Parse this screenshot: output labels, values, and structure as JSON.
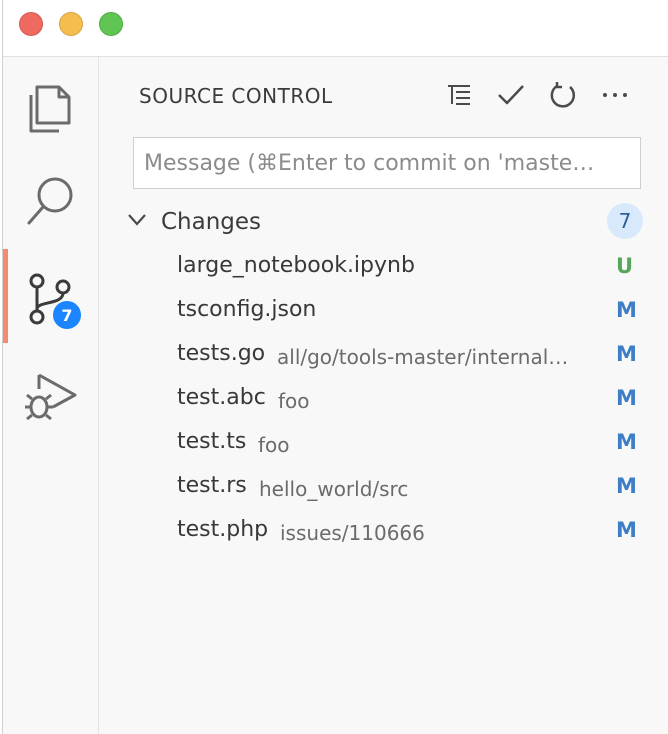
{
  "window": {
    "controls": [
      "close",
      "minimize",
      "maximize"
    ],
    "colors": {
      "close": "#ee6a5f",
      "minimize": "#f5bd4f",
      "maximize": "#61c554"
    }
  },
  "activity_bar": {
    "items": [
      {
        "name": "explorer",
        "icon": "files-icon"
      },
      {
        "name": "search",
        "icon": "search-icon"
      },
      {
        "name": "source-control",
        "icon": "source-control-icon",
        "badge": "7",
        "active": true
      },
      {
        "name": "run-and-debug",
        "icon": "debug-icon"
      }
    ],
    "active_indicator_color": "#f28b70",
    "badge_color": "#1a85ff"
  },
  "source_control": {
    "title": "SOURCE CONTROL",
    "actions": [
      "view-as-tree-icon",
      "commit-check-icon",
      "refresh-icon",
      "more-actions-icon"
    ],
    "message_placeholder": "Message (⌘Enter to commit on 'maste…",
    "changes": {
      "label": "Changes",
      "count": "7",
      "files": [
        {
          "name": "large_notebook.ipynb",
          "path": "",
          "status": "U"
        },
        {
          "name": "tsconfig.json",
          "path": "",
          "status": "M"
        },
        {
          "name": "tests.go",
          "path": "all/go/tools-master/internal…",
          "status": "M"
        },
        {
          "name": "test.abc",
          "path": "foo",
          "status": "M"
        },
        {
          "name": "test.ts",
          "path": "foo",
          "status": "M"
        },
        {
          "name": "test.rs",
          "path": "hello_world/src",
          "status": "M"
        },
        {
          "name": "test.php",
          "path": "issues/110666",
          "status": "M"
        }
      ]
    },
    "status_colors": {
      "M": "#3d7ec6",
      "U": "#58a55c"
    }
  }
}
